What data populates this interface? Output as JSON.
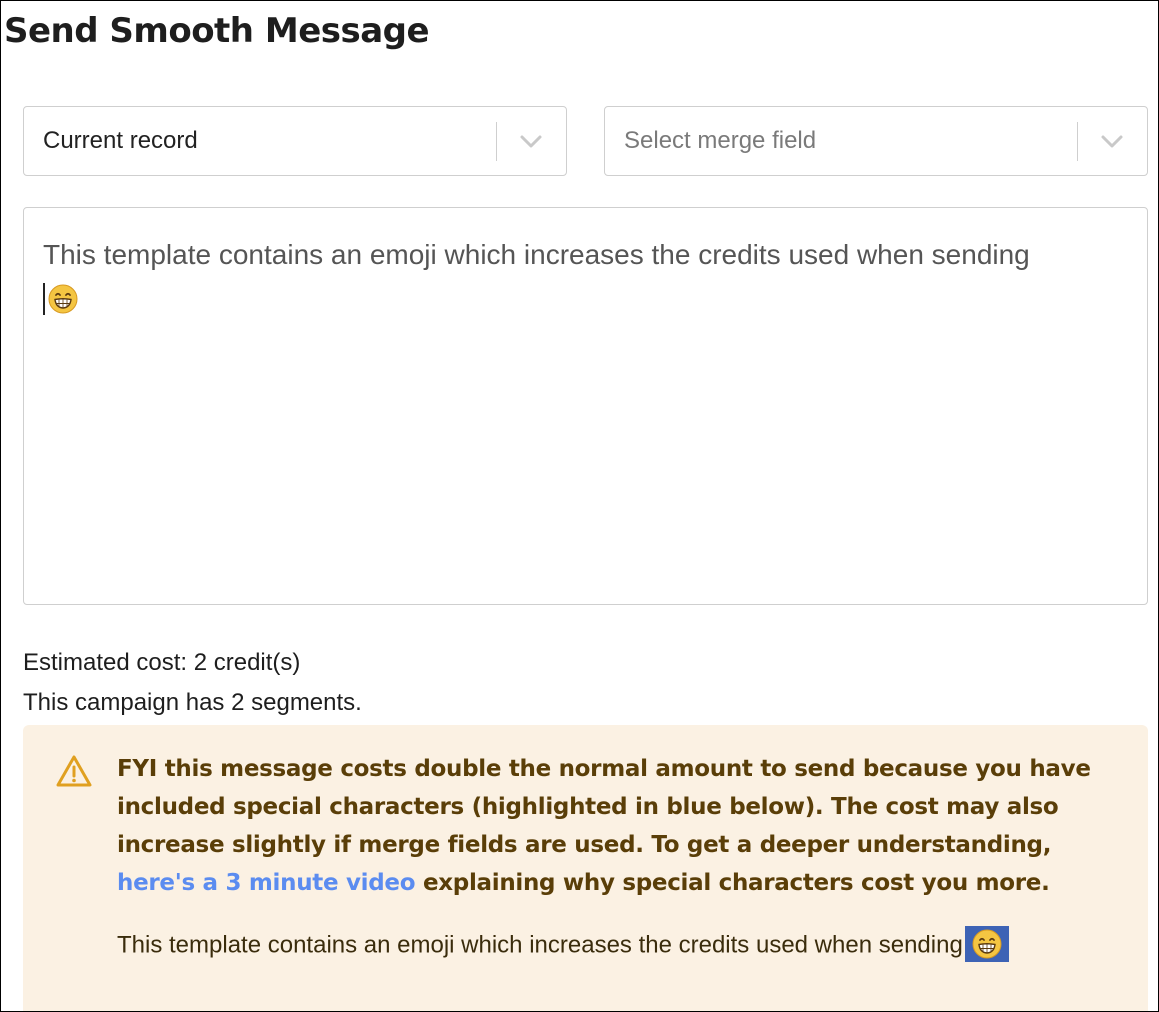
{
  "page": {
    "title": "Send Smooth Message"
  },
  "record_select": {
    "value": "Current record"
  },
  "merge_select": {
    "placeholder": "Select merge field"
  },
  "editor": {
    "text": "This template contains an emoji which increases the credits used when sending",
    "emoji": "grinning-face-emoji"
  },
  "stats": {
    "cost_text": "Estimated cost: 2 credit(s)",
    "segments_text": "This campaign has 2 segments."
  },
  "notice": {
    "icon": "warning-icon",
    "message_before": "FYI this message costs double the normal amount to send because you have included special characters (highlighted in blue below). The cost may also increase slightly if merge fields are used. To get a deeper understanding, ",
    "link_text": "here's a 3 minute video",
    "message_after": " explaining why special characters cost you more.",
    "preview_text": "This template contains an emoji which increases the credits used when sending"
  },
  "colors": {
    "notice_bg": "#fbf1e3",
    "notice_text": "#5a3e08",
    "link": "#5b8cf0",
    "highlight": "#3d63b5",
    "warning": "#e0a020"
  }
}
